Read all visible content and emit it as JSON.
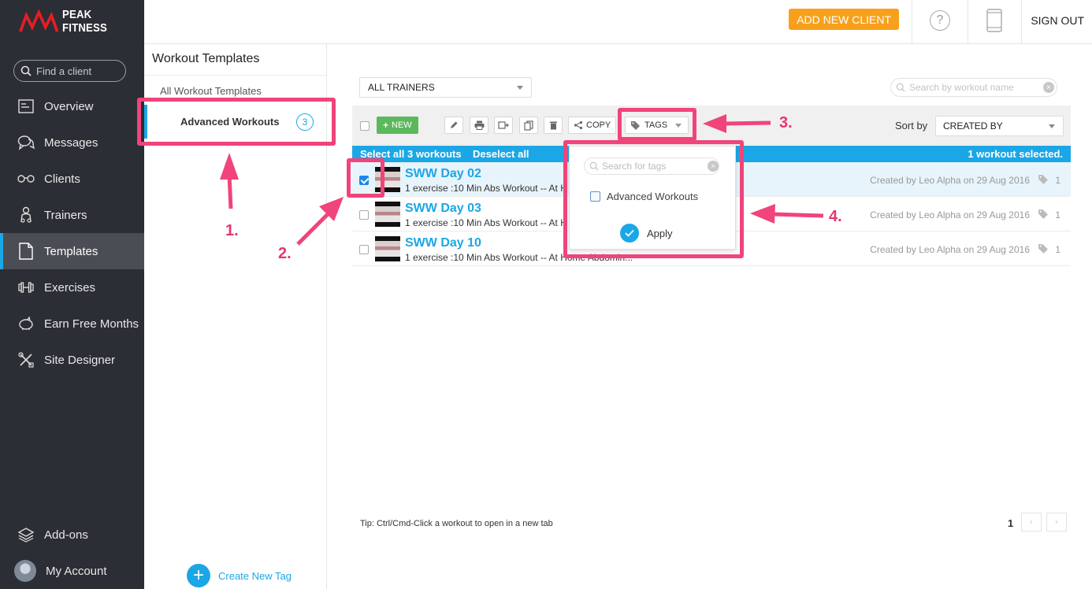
{
  "app": {
    "name": "PEAK FITNESS"
  },
  "sidebar": {
    "search_placeholder": "Find a client",
    "items": [
      {
        "label": "Overview",
        "icon": "overview-icon"
      },
      {
        "label": "Messages",
        "icon": "messages-icon"
      },
      {
        "label": "Clients",
        "icon": "clients-icon"
      },
      {
        "label": "Trainers",
        "icon": "trainers-icon"
      },
      {
        "label": "Templates",
        "icon": "templates-icon",
        "active": true
      },
      {
        "label": "Exercises",
        "icon": "dumbbell-icon"
      },
      {
        "label": "Earn Free Months",
        "icon": "piggy-bank-icon"
      },
      {
        "label": "Site Designer",
        "icon": "tools-icon"
      }
    ],
    "bottom": [
      {
        "label": "Add-ons",
        "icon": "layers-icon"
      },
      {
        "label": "My Account",
        "icon": "avatar"
      }
    ]
  },
  "topbar": {
    "add_client": "ADD NEW CLIENT",
    "help": "?",
    "sign_out": "SIGN OUT"
  },
  "tag_panel": {
    "title": "Workout Templates",
    "all": "All Workout Templates",
    "selected_tag": "Advanced Workouts",
    "selected_count": "3",
    "create": "Create New Tag"
  },
  "filters": {
    "trainer": "ALL TRAINERS",
    "search_placeholder": "Search by workout name"
  },
  "toolbar": {
    "new": "NEW",
    "copy": "COPY",
    "tags": "TAGS",
    "sort_label": "Sort by",
    "sort_value": "CREATED BY"
  },
  "selection": {
    "select_all": "Select all 3 workouts",
    "deselect_all": "Deselect all",
    "status": "1 workout selected."
  },
  "workouts": [
    {
      "title": "SWW Day 02",
      "desc": "1 exercise :10 Min Abs Workout -- At H",
      "created": "Created by Leo Alpha on 29 Aug 2016",
      "tags": "1",
      "checked": true
    },
    {
      "title": "SWW Day 03",
      "desc": "1 exercise :10 Min Abs Workout -- At H",
      "created": "Created by Leo Alpha on 29 Aug 2016",
      "tags": "1",
      "checked": false
    },
    {
      "title": "SWW Day 10",
      "desc": "1 exercise :10 Min Abs Workout -- At Home Abdomin...",
      "created": "Created by Leo Alpha on 29 Aug 2016",
      "tags": "1",
      "checked": false
    }
  ],
  "tag_dropdown": {
    "search_placeholder": "Search for tags",
    "option": "Advanced Workouts",
    "apply": "Apply"
  },
  "footer": {
    "tip": "Tip: Ctrl/Cmd-Click a workout to open in a new tab",
    "page": "1"
  },
  "annotations": [
    "1.",
    "2.",
    "3.",
    "4."
  ],
  "colors": {
    "accent": "#1ba7e6",
    "orange": "#f8a01c",
    "annotation": "#f0447a",
    "sidebar": "#2b2e34"
  }
}
